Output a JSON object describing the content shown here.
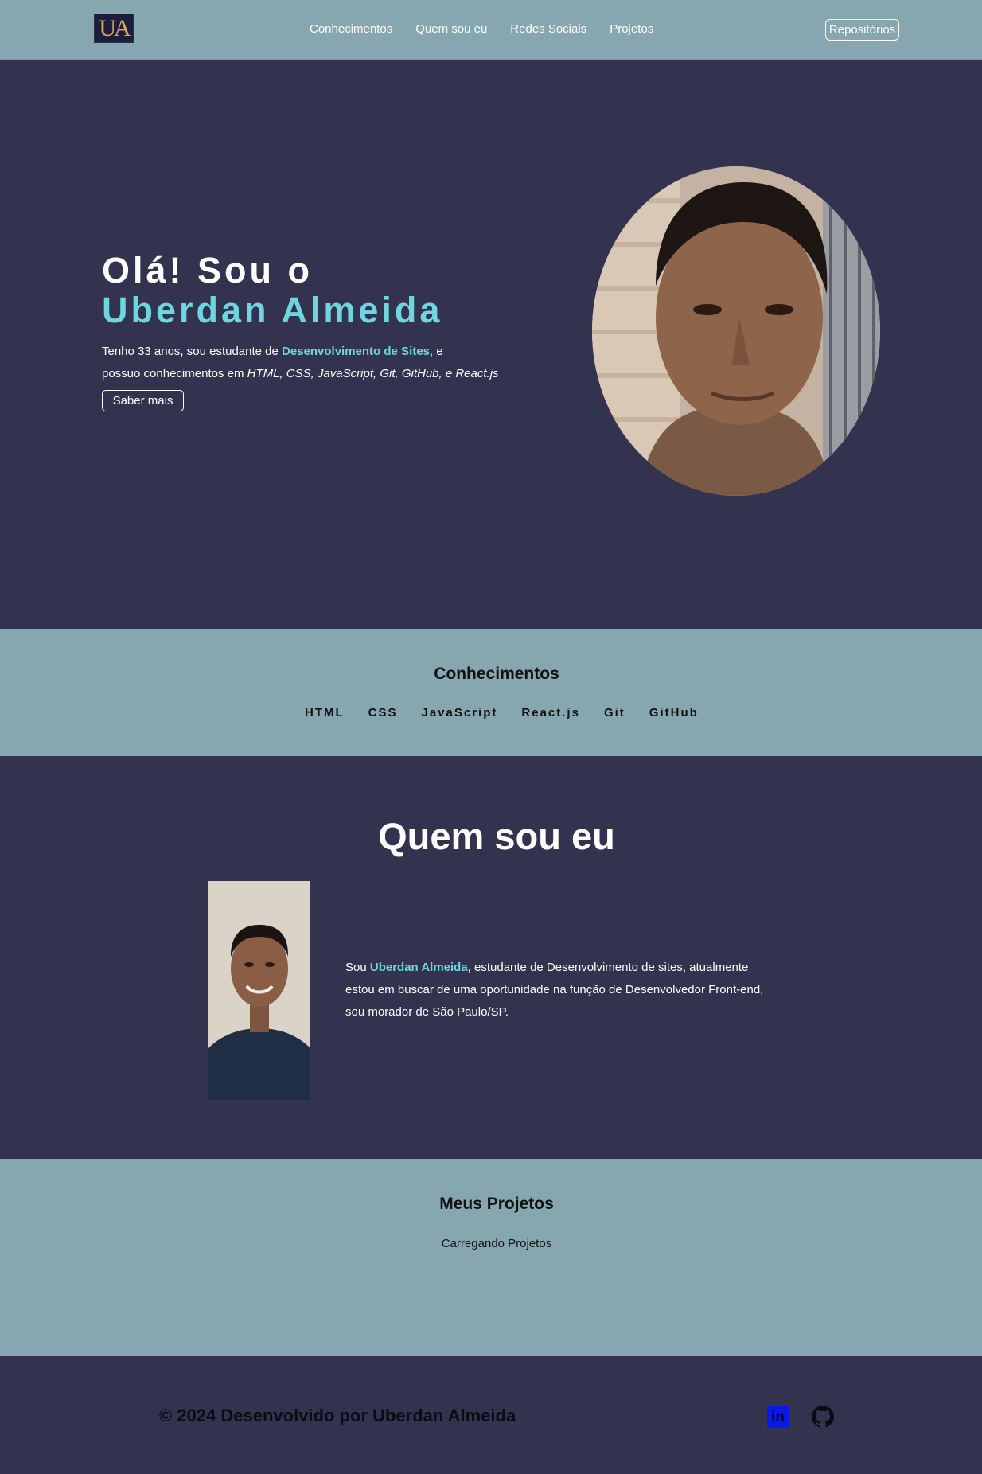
{
  "nav": {
    "logo_text": "UA",
    "links": [
      "Conhecimentos",
      "Quem sou eu",
      "Redes Sociais",
      "Projetos"
    ],
    "repo_button": "Repositórios"
  },
  "hero": {
    "title_line1": "Olá! Sou o",
    "title_line2": "Uberdan Almeida",
    "desc_prefix": "Tenho 33 anos, sou estudante de ",
    "desc_highlight": "Desenvolvimento de Sites",
    "desc_mid": ", e",
    "desc_line2_prefix": "possuo conhecimentos em ",
    "desc_skills": "HTML, CSS, JavaScript, Git, GitHub, e React.js",
    "button": "Saber mais"
  },
  "skills": {
    "title": "Conhecimentos",
    "items": [
      "HTML",
      "CSS",
      "JavaScript",
      "React.js",
      "Git",
      "GitHub"
    ]
  },
  "about": {
    "title": "Quem sou eu",
    "text_prefix": "Sou ",
    "text_name": "Uberdan Almeida",
    "text_rest": ", estudante de Desenvolvimento de sites, atualmente estou em buscar de uma oportunidade na função de Desenvolvedor Front-end, sou morador de São Paulo/SP."
  },
  "projects": {
    "title": "Meus Projetos",
    "status": "Carregando Projetos"
  },
  "footer": {
    "copyright": "© 2024 Desenvolvido por Uberdan Almeida",
    "linkedin_icon": "linkedin-icon",
    "github_icon": "github-icon"
  },
  "colors": {
    "nav_bg": "#87a7b0",
    "dark_bg": "#34334f",
    "accent": "#6fd6e0",
    "linkedin": "#0b19e8"
  }
}
